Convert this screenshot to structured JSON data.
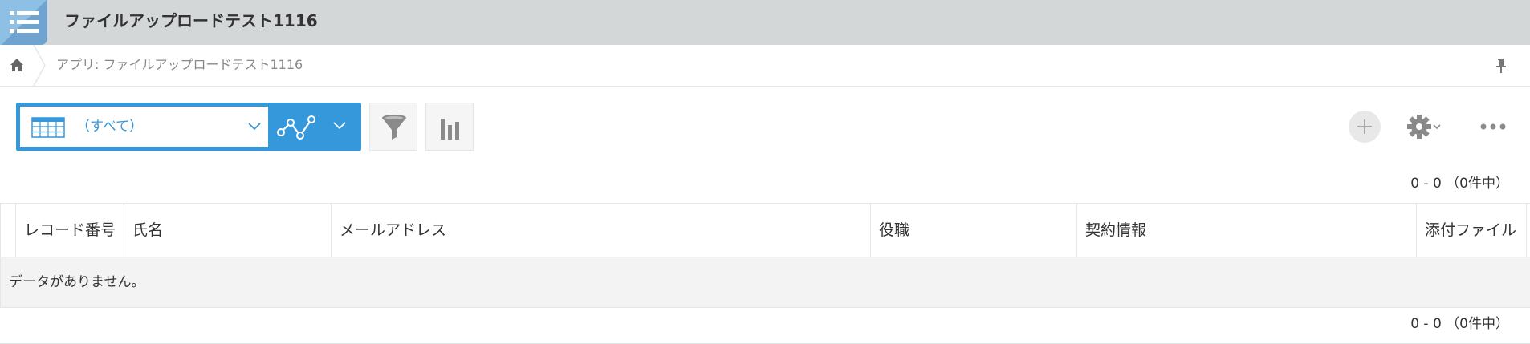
{
  "app": {
    "title": "ファイルアップロードテスト1116",
    "icon": "list-app-icon"
  },
  "breadcrumb": {
    "home_icon": "home-icon",
    "current": "アプリ: ファイルアップロードテスト1116",
    "pin_icon": "pin-icon"
  },
  "toolbar": {
    "view_select_value": "（すべて）",
    "view_icon": "table-view-icon",
    "graph_icon": "graph-icon",
    "filter_icon": "filter-icon",
    "stats_icon": "bar-chart-icon",
    "add_icon": "plus-icon",
    "settings_icon": "gear-icon",
    "more_icon": "more-icon"
  },
  "pager": {
    "top": "0 - 0 （0件中）",
    "bottom": "0 - 0 （0件中）"
  },
  "table": {
    "columns": [
      "レコード番号",
      "氏名",
      "メールアドレス",
      "役職",
      "契約情報",
      "添付ファイル"
    ],
    "empty_message": "データがありません。"
  },
  "colors": {
    "header_bg": "#d4d7d8",
    "accent": "#3498db",
    "app_icon": "#7fb3dc"
  }
}
